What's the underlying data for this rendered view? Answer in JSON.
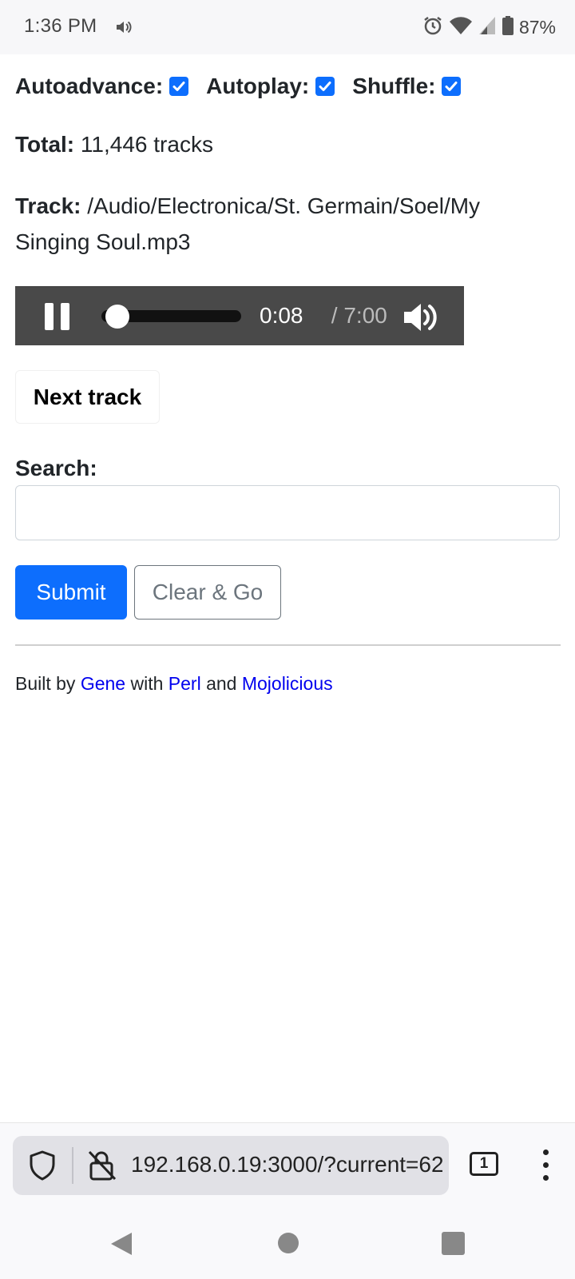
{
  "status_bar": {
    "time": "1:36 PM",
    "battery_pct": "87%",
    "icons": [
      "sound-icon",
      "alarm-icon",
      "wifi-icon",
      "signal-icon",
      "battery-icon"
    ]
  },
  "options": {
    "autoadvance_label": "Autoadvance:",
    "autoplay_label": "Autoplay:",
    "shuffle_label": "Shuffle:",
    "autoadvance_checked": true,
    "autoplay_checked": true,
    "shuffle_checked": true
  },
  "total": {
    "label": "Total:",
    "value": "11,446 tracks"
  },
  "track": {
    "label": "Track:",
    "value": "/Audio/Electronica/St. Germain/Soel/My Singing Soul.mp3"
  },
  "player": {
    "current_time": "0:08",
    "duration": "7:00",
    "separator_duration": " / 7:00",
    "progress_fraction": 0.019
  },
  "buttons": {
    "next_track": "Next track",
    "submit": "Submit",
    "clear_go": "Clear & Go"
  },
  "search": {
    "label": "Search:",
    "value": "",
    "placeholder": ""
  },
  "footer": {
    "prefix": "Built by ",
    "gene": "Gene",
    "with": " with ",
    "perl": "Perl",
    "and": " and ",
    "mojolicious": "Mojolicious"
  },
  "browser": {
    "url": "192.168.0.19:3000/?current=62",
    "tab_count": "1"
  },
  "colors": {
    "primary": "#0d6efd",
    "link": "#0000ee",
    "player_bg": "#494949"
  }
}
